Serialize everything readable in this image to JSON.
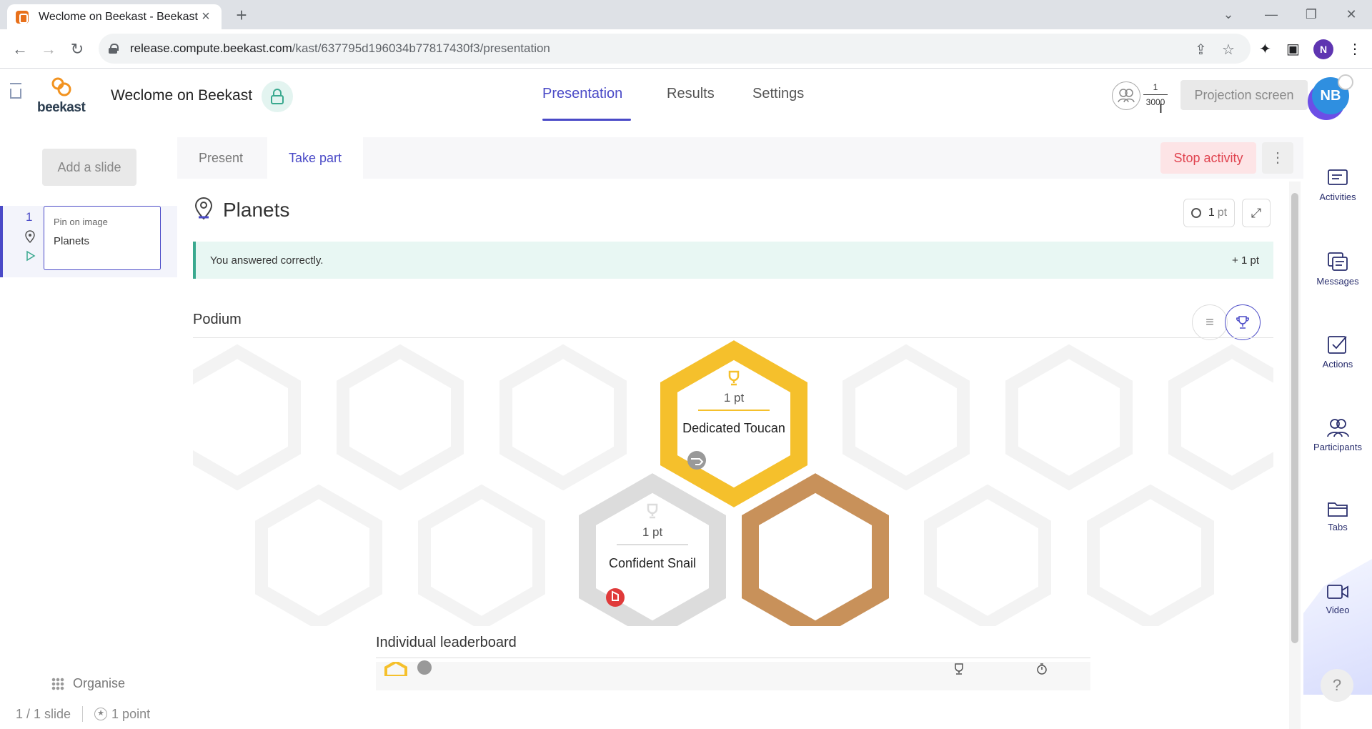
{
  "browser": {
    "tab_title": "Weclome on Beekast - Beekast",
    "url_host": "release.compute.beekast.com",
    "url_path": "/kast/637795d196034b77817430f3/presentation",
    "profile_initial": "N"
  },
  "header": {
    "logo_text": "beekast",
    "title": "Weclome on Beekast",
    "nav": [
      "Presentation",
      "Results",
      "Settings"
    ],
    "active_nav": "Presentation",
    "participants_current": "1",
    "participants_max": "3000",
    "projection_label": "Projection screen",
    "avatar_initials": "NB"
  },
  "sidebar": {
    "add_slide_label": "Add a slide",
    "slides": [
      {
        "number": "1",
        "type": "Pin on image",
        "name": "Planets"
      }
    ],
    "organise_label": "Organise",
    "slide_count": "1 / 1 slide",
    "points_total": "1 point"
  },
  "main": {
    "mode_tabs": [
      "Present",
      "Take part"
    ],
    "active_mode": "Take part",
    "stop_label": "Stop activity",
    "question_title": "Planets",
    "points_value": "1",
    "points_unit": "pt",
    "answer_message": "You answered correctly.",
    "answer_points": "+ 1 pt",
    "podium_title": "Podium",
    "podium": [
      {
        "rank": 1,
        "points": "1 pt",
        "name": "Dedicated Toucan",
        "color": "#f5c02c"
      },
      {
        "rank": 2,
        "points": "1 pt",
        "name": "Confident Snail",
        "color": "#dcdcdc"
      },
      {
        "rank": 3,
        "points": "",
        "name": "",
        "color": "#c8915a"
      }
    ],
    "leaderboard_title": "Individual leaderboard"
  },
  "rail": {
    "items": [
      "Activities",
      "Messages",
      "Actions",
      "Participants",
      "Tabs",
      "Video"
    ],
    "help_label": "?"
  },
  "colors": {
    "accent": "#4a4ac7",
    "danger": "#e0434f",
    "success": "#3aa98f"
  }
}
